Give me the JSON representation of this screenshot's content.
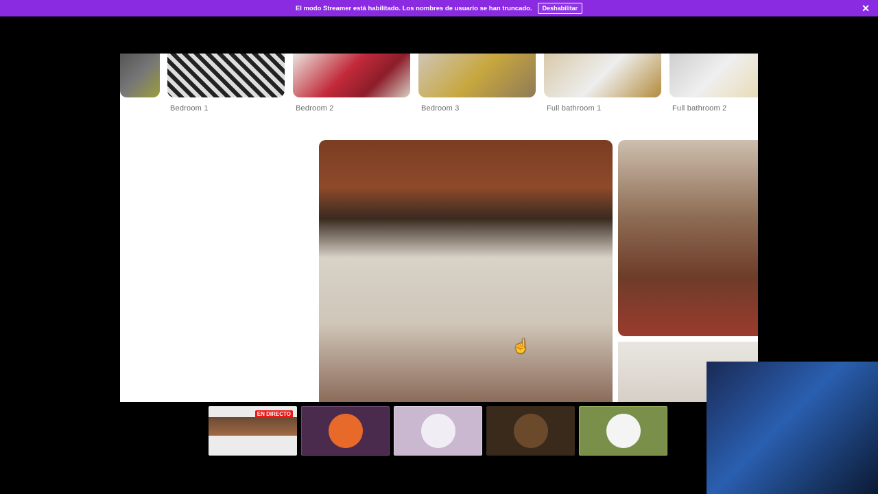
{
  "banner": {
    "message": "El modo Streamer está habilitado. Los nombres de usuario se han truncado.",
    "button_label": "Deshabilitar",
    "close_glyph": "✕"
  },
  "listing": {
    "rooms": [
      {
        "label": "Bedroom 1"
      },
      {
        "label": "Bedroom 2"
      },
      {
        "label": "Bedroom 3"
      },
      {
        "label": "Full bathroom 1"
      },
      {
        "label": "Full bathroom 2"
      }
    ]
  },
  "channels": {
    "live_badge": "EN DIRECTO"
  },
  "colors": {
    "banner": "#8a2be2",
    "live": "#e91916",
    "thumb2": "#4a2b4e",
    "thumb3": "#c9b8d0",
    "thumb4": "#3a2a1c",
    "thumb5": "#7a8f4a"
  }
}
